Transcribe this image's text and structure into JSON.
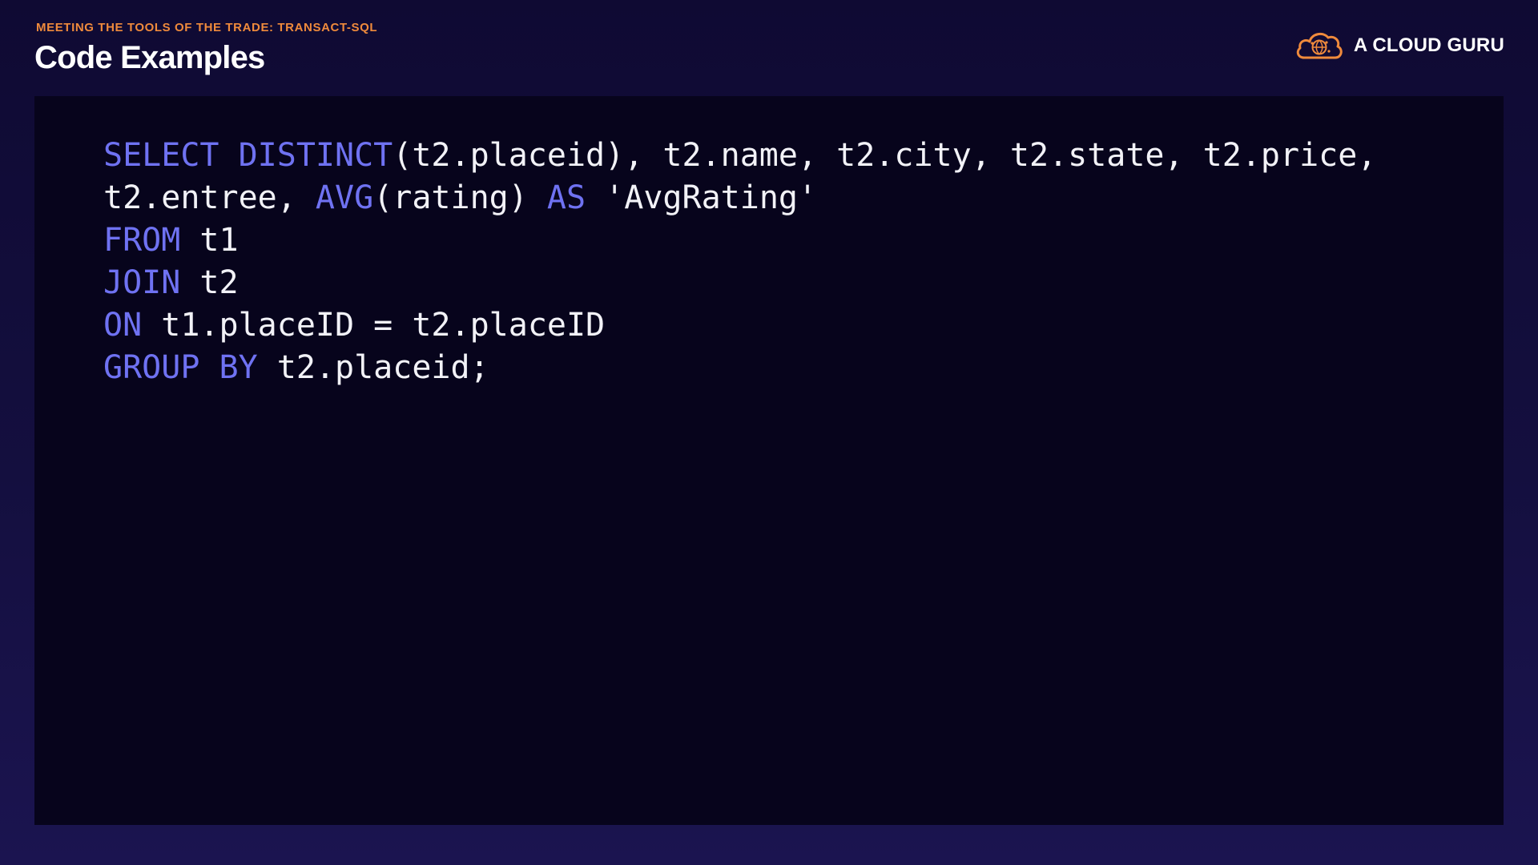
{
  "header": {
    "subtitle": "MEETING THE TOOLS OF THE TRADE: TRANSACT-SQL",
    "title": "Code Examples"
  },
  "brand": {
    "logo_icon": "cloud-logo-icon",
    "name": "A CLOUD GURU"
  },
  "colors": {
    "accent": "#ef8a3c",
    "keyword": "#6f72f2",
    "code_text": "#f2f2f7",
    "panel_bg": "#07041c",
    "slide_bg": "#120c3a"
  },
  "code": {
    "language": "sql",
    "lines": [
      [
        {
          "t": "SELECT DISTINCT",
          "kw": true
        },
        {
          "t": "(t2.placeid), t2.name, t2.city, t2.state, t2.price,",
          "kw": false
        }
      ],
      [
        {
          "t": "t2.entree, ",
          "kw": false
        },
        {
          "t": "AVG",
          "kw": true
        },
        {
          "t": "(rating) ",
          "kw": false
        },
        {
          "t": "AS",
          "kw": true
        },
        {
          "t": " 'AvgRating'",
          "kw": false
        }
      ],
      [
        {
          "t": "FROM",
          "kw": true
        },
        {
          "t": " t1",
          "kw": false
        }
      ],
      [
        {
          "t": "JOIN",
          "kw": true
        },
        {
          "t": " t2",
          "kw": false
        }
      ],
      [
        {
          "t": "ON",
          "kw": true
        },
        {
          "t": " t1.placeID = t2.placeID",
          "kw": false
        }
      ],
      [
        {
          "t": "GROUP BY",
          "kw": true
        },
        {
          "t": " t2.placeid;",
          "kw": false
        }
      ]
    ]
  }
}
